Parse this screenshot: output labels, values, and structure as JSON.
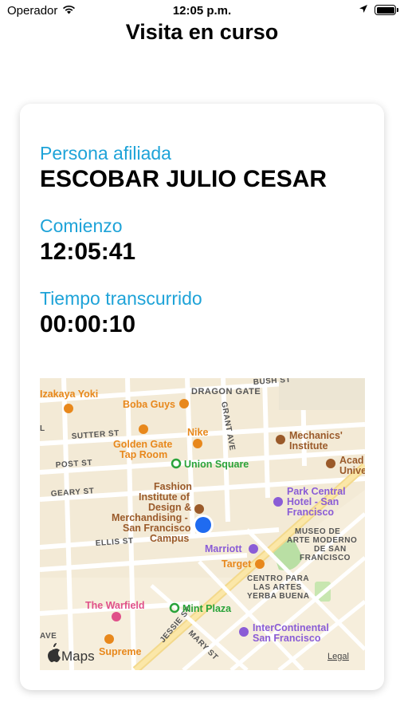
{
  "status_bar": {
    "carrier": "Operador",
    "time": "12:05 p.m."
  },
  "nav": {
    "title": "Visita en curso"
  },
  "visit": {
    "affiliate_label": "Persona afiliada",
    "affiliate_name": "ESCOBAR JULIO CESAR",
    "start_label": "Comienzo",
    "start_time": "12:05:41",
    "elapsed_label": "Tiempo transcurrido",
    "elapsed_time": "00:00:10"
  },
  "map": {
    "attribution": "Maps",
    "legal": "Legal",
    "pois": {
      "izakaya": "Izakaya Yoki",
      "boba": "Boba Guys",
      "dragon": "DRAGON GATE",
      "nike": "Nike",
      "golden_gate_1": "Golden Gate",
      "golden_gate_2": "Tap Room",
      "union_square": "Union Square",
      "mechanics_1": "Mechanics'",
      "mechanics_2": "Institute",
      "acad_1": "Acad",
      "acad_2": "Unive",
      "fidm_1": "Fashion",
      "fidm_2": "Institute of",
      "fidm_3": "Design &",
      "fidm_4": "Merchandising -",
      "fidm_5": "San Francisco",
      "fidm_6": "Campus",
      "park_central_1": "Park Central",
      "park_central_2": "Hotel - San",
      "park_central_3": "Francisco",
      "museo_1": "MUSEO DE",
      "museo_2": "ARTE MODERNO",
      "museo_3": "DE SAN",
      "museo_4": "FRANCISCO",
      "marriott": "Marriott",
      "target": "Target",
      "centro_1": "CENTRO PARA",
      "centro_2": "LAS ARTES",
      "centro_3": "YERBA BUENA",
      "warfield": "The Warfield",
      "mint_plaza": "Mint Plaza",
      "intercontinental_1": "InterContinental",
      "intercontinental_2": "San Francisco",
      "supreme": "Supreme"
    },
    "streets": {
      "bush": "BUSH ST",
      "sutter": "SUTTER ST",
      "post": "POST ST",
      "geary": "GEARY ST",
      "ellis": "ELLIS ST",
      "grant": "GRANT AVE",
      "jessie": "JESSIE ST",
      "mary": "MARY ST",
      "ave": "AVE",
      "l": "L"
    },
    "colors": {
      "green_poi": "#2aa33a",
      "orange_poi": "#e8881c",
      "purple_poi": "#8a5cd6",
      "brown_poi": "#9a5a2a",
      "pink_poi": "#e0508a",
      "location": "#1f6bf0"
    }
  }
}
